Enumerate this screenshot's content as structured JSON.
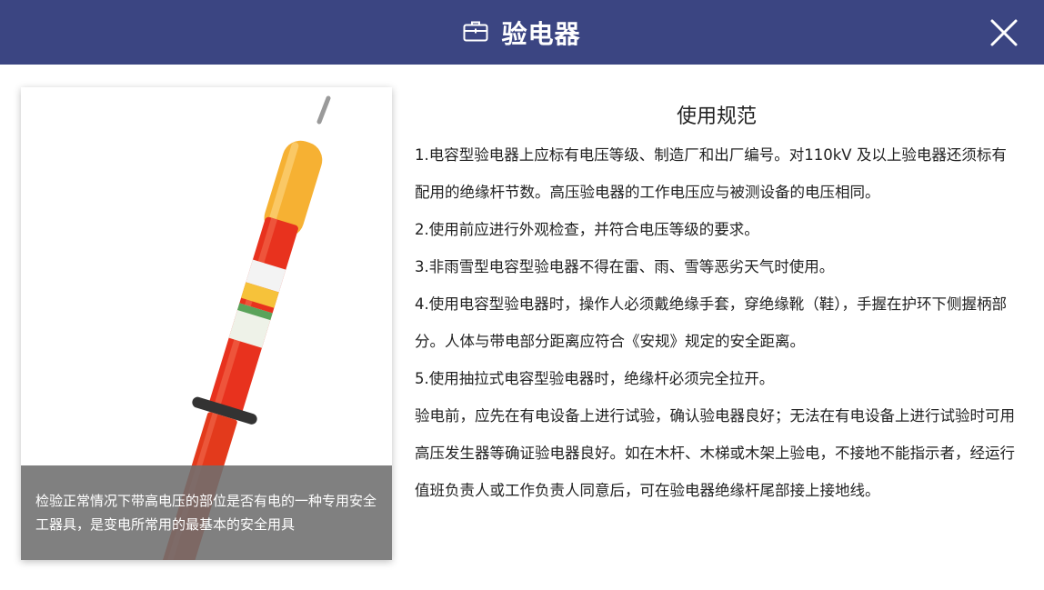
{
  "header": {
    "title": "验电器",
    "icon": "toolbox-icon",
    "close_icon": "close-icon",
    "background": "#3b4582"
  },
  "card": {
    "image": "high-voltage-detector-photo",
    "caption": "检验正常情况下带高电压的部位是否有电的一种专用安全工器具，是变电所常用的最基本的安全用具"
  },
  "content": {
    "title": "使用规范",
    "paragraphs": [
      "1.电容型验电器上应标有电压等级、制造厂和出厂编号。对110kV 及以上验电器还须标有配用的绝缘杆节数。高压验电器的工作电压应与被测设备的电压相同。",
      "2.使用前应进行外观检查，并符合电压等级的要求。",
      "3.非雨雪型电容型验电器不得在雷、雨、雪等恶劣天气时使用。",
      "4.使用电容型验电器时，操作人必须戴绝缘手套，穿绝缘靴（鞋），手握在护环下侧握柄部分。人体与带电部分距离应符合《安规》规定的安全距离。",
      "5.使用抽拉式电容型验电器时，绝缘杆必须完全拉开。",
      "验电前，应先在有电设备上进行试验，确认验电器良好；无法在有电设备上进行试验时可用高压发生器等确证验电器良好。如在木杆、木梯或木架上验电，不接地不能指示者，经运行值班负责人或工作负责人同意后，可在验电器绝缘杆尾部接上接地线。"
    ]
  }
}
